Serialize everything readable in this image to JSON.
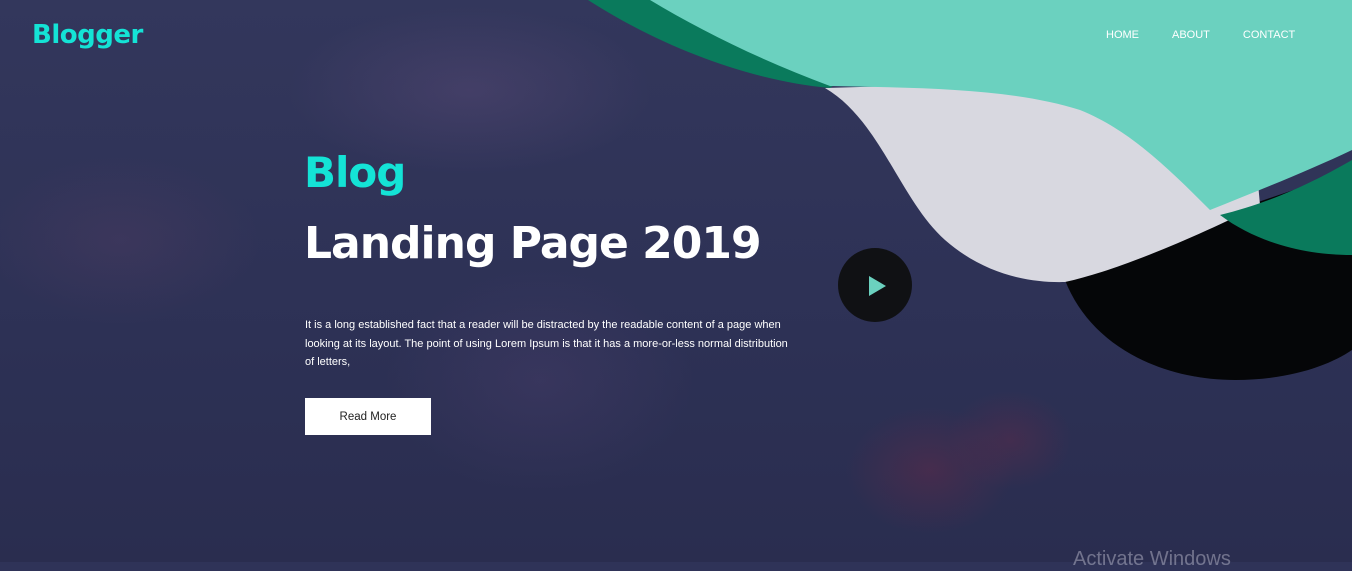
{
  "brand": {
    "logo": "Blogger"
  },
  "nav": {
    "items": [
      "HOME",
      "ABOUT",
      "CONTACT"
    ]
  },
  "hero": {
    "kicker": "Blog",
    "headline": "Landing Page 2019",
    "description": "It is a long established fact that a reader will be distracted by the readable content of a page when looking at its layout. The point of using Lorem Ipsum is that it has a more-or-less normal distribution of letters,",
    "cta_label": "Read More",
    "play_icon": "play-icon"
  },
  "system": {
    "watermark": "Activate Windows"
  },
  "colors": {
    "accent": "#14e3d6",
    "background": "#2f3358",
    "wave_teal": "#6bd1bf",
    "wave_dark_teal": "#0a7a5c",
    "wave_light": "#d8d8e0",
    "wave_black": "#050608",
    "button_bg": "#ffffff"
  }
}
